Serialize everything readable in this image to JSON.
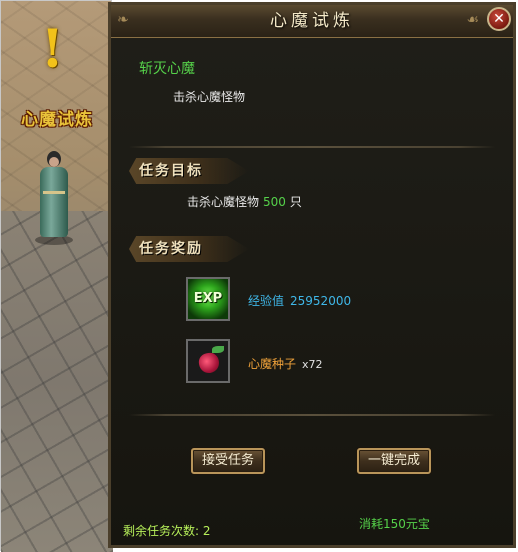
{
  "npc": {
    "name": "心魔试炼",
    "marker": "!"
  },
  "dialog": {
    "title": "心魔试炼",
    "close_glyph": "✕",
    "quest_name": "斩灭心魔",
    "quest_desc": "击杀心魔怪物",
    "objective_header": "任务目标",
    "objective": {
      "text": "击杀心魔怪物",
      "count": "500",
      "unit": "只"
    },
    "reward_header": "任务奖励",
    "rewards": [
      {
        "icon": "exp-icon",
        "icon_text": "EXP",
        "label": "经验值",
        "value": "25952000"
      },
      {
        "icon": "heart-seed-icon",
        "label": "心魔种子",
        "value": "x72"
      }
    ],
    "buttons": {
      "accept": "接受任务",
      "complete": "一键完成"
    },
    "cost_text": "消耗150元宝",
    "remaining_text": "剩余任务次数: 2"
  },
  "colors": {
    "quest_green": "#55d14a",
    "exp_blue": "#3fb7e8",
    "item_orange": "#f0a23a",
    "remaining_yellowgreen": "#b7f05a"
  }
}
